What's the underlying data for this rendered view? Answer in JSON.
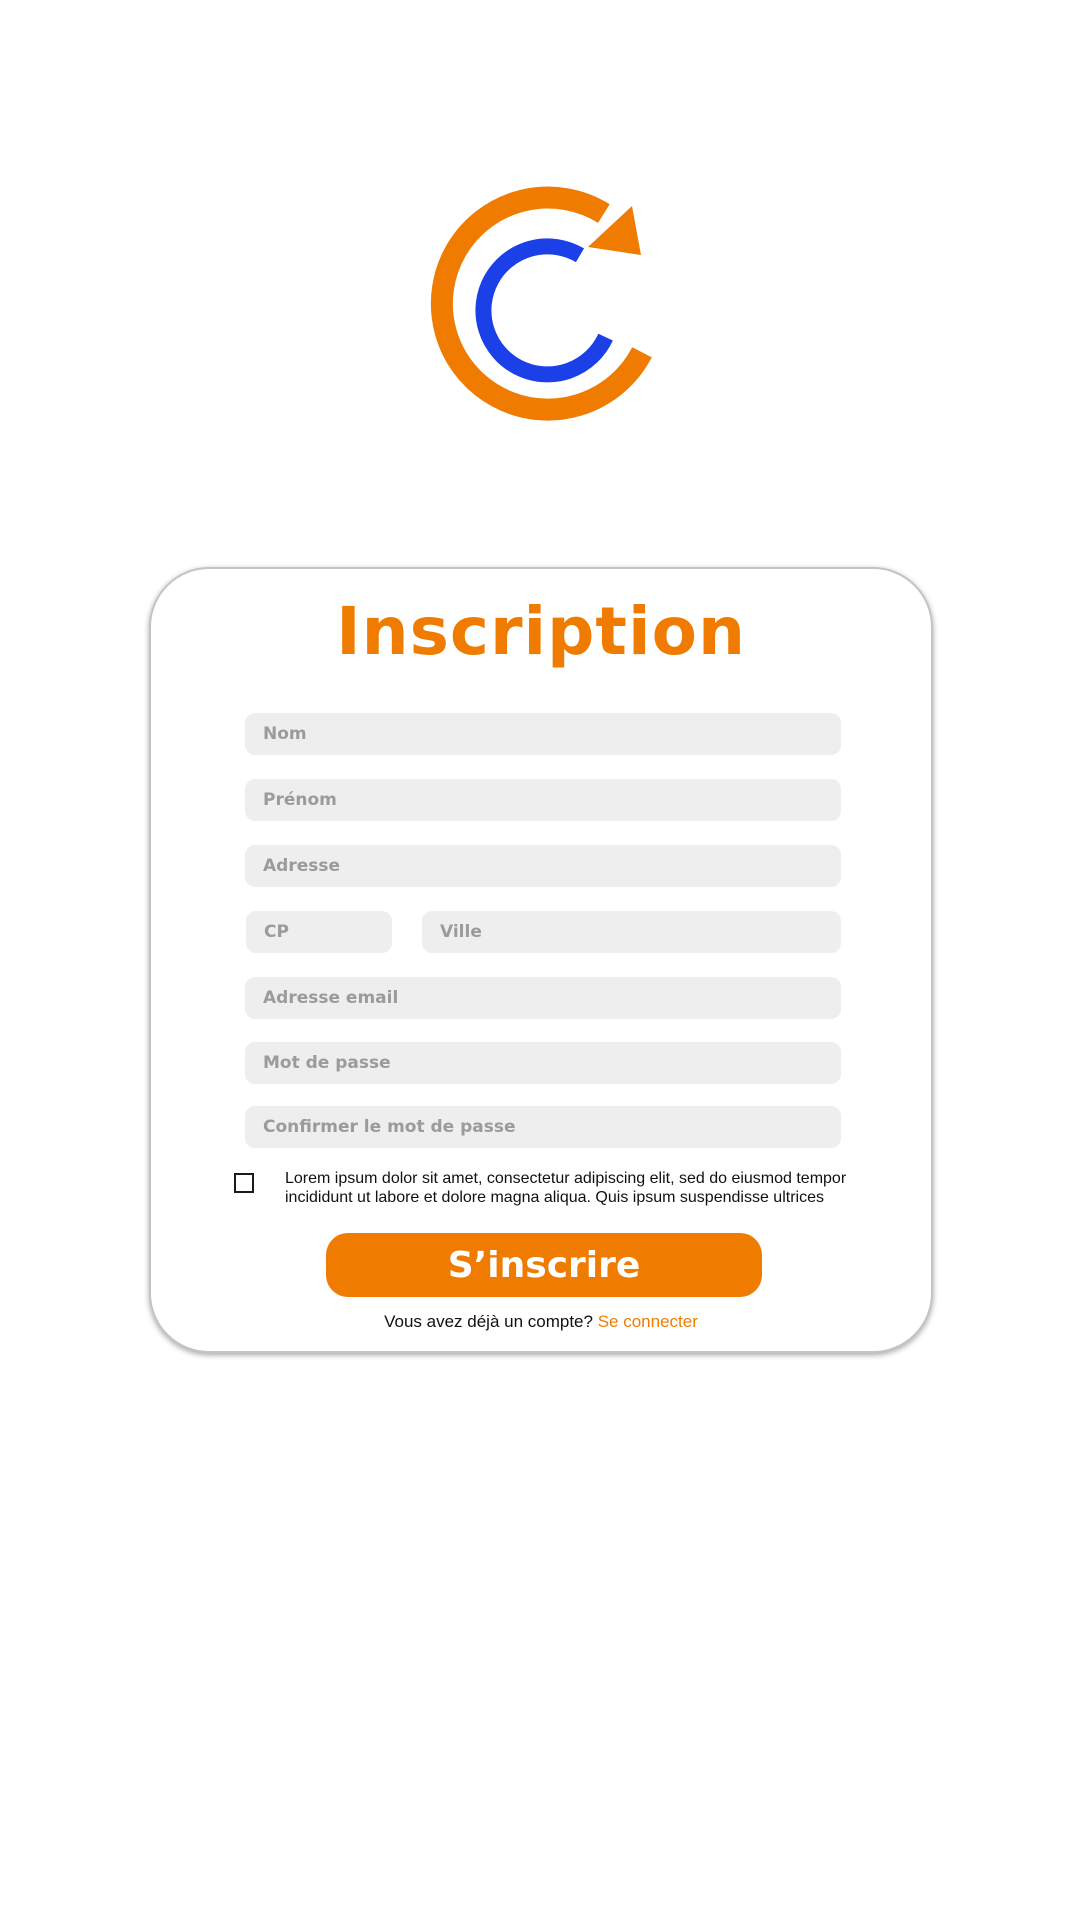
{
  "colors": {
    "accent": "#ef7c00",
    "blue": "#1c40e8",
    "field_bg": "#eeeeee",
    "placeholder": "#9b9b9b"
  },
  "logo": {
    "icon": "refresh-c-logo-icon"
  },
  "form": {
    "title": "Inscription",
    "fields": {
      "nom": {
        "placeholder": "Nom",
        "value": ""
      },
      "prenom": {
        "placeholder": "Prénom",
        "value": ""
      },
      "adresse": {
        "placeholder": "Adresse",
        "value": ""
      },
      "cp": {
        "placeholder": "CP",
        "value": ""
      },
      "ville": {
        "placeholder": "Ville",
        "value": ""
      },
      "email": {
        "placeholder": "Adresse email",
        "value": ""
      },
      "password": {
        "placeholder": "Mot de passe",
        "value": ""
      },
      "password_confirm": {
        "placeholder": "Confirmer le mot de passe",
        "value": ""
      }
    },
    "terms": {
      "checked": false,
      "line1": "Lorem ipsum dolor sit amet, consectetur adipiscing elit, sed do eiusmod tempor",
      "line2": "incididunt ut labore et dolore magna aliqua. Quis ipsum suspendisse ultrices"
    },
    "submit_label": "S’inscrire",
    "login_prompt": "Vous avez déjà un compte?",
    "login_link": "Se connecter"
  }
}
